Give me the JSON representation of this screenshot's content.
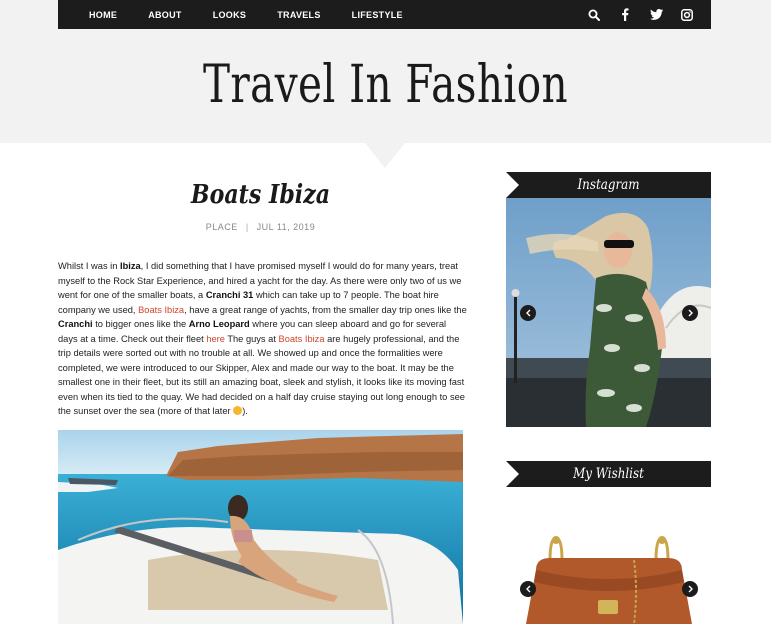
{
  "nav": {
    "items": [
      {
        "label": "HOME"
      },
      {
        "label": "ABOUT"
      },
      {
        "label": "LOOKS"
      },
      {
        "label": "TRAVELS"
      },
      {
        "label": "LIFESTYLE"
      }
    ],
    "icons": [
      "search-icon",
      "facebook-icon",
      "twitter-icon",
      "instagram-icon"
    ]
  },
  "site": {
    "title": "Travel In Fashion"
  },
  "post": {
    "title": "Boats Ibiza",
    "category": "PLACE",
    "separator": "|",
    "date": "JUL 11, 2019",
    "body": {
      "t1": "Whilst I was in ",
      "b_ibiza": "Ibiza",
      "t2": ",  I did something that I have promised myself I would do for many years, treat myself to the Rock Star Experience, and hired a yacht for the day.  As there were only two of us we went for one of the smaller boats, a ",
      "b_cranchi31": "Cranchi 31",
      "t3": " which can take up to 7 people.  The boat hire company we used, ",
      "link_boats_ibiza_1": "Boats Ibiza",
      "t4": ", have a great range of yachts, from the smaller day trip ones like the ",
      "b_cranchi": "Cranchi",
      "t5": " to bigger ones like the ",
      "b_arno": "Arno Leopard",
      "t6": " where you can sleep aboard and go for several days at a time.  Check out their fleet ",
      "link_here": "here",
      "t7": "  The guys at ",
      "link_boats_ibiza_2": "Boats Ibiza",
      "t8": " are hugely professional, and the trip details were sorted out with no trouble at all.  We showed up and once the formalities were completed, we were introduced to our Skipper, Alex and made our way to the boat.  It may be the smallest one in their fleet, but its still an amazing boat, sleek and stylish, it looks like its moving fast even when its tied to the quay.  We had decided on a half day cruise staying out long enough to see the sunset over the sea (more of that later ",
      "t9": ")."
    }
  },
  "sidebar": {
    "instagram_title": "Instagram",
    "wishlist_title": "My Wishlist"
  },
  "colors": {
    "nav_bg": "#1c1c1c",
    "hero_bg": "#f2f2f2",
    "link": "#d0462a"
  }
}
